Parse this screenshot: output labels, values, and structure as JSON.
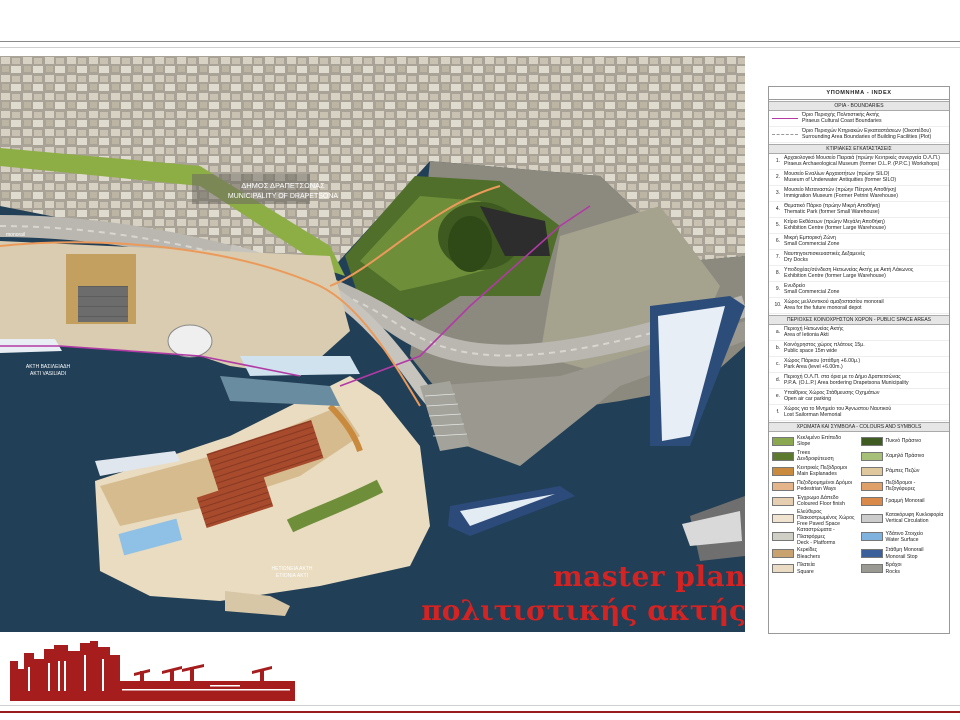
{
  "title": {
    "line1": "master plan",
    "line2": "πολιτιστικής ακτής"
  },
  "map_labels": {
    "municipality_gr": "ΔΗΜΟΣ ΔΡΑΠΕΤΣΩΝΑΣ",
    "municipality_en": "MUNICIPALITY OF DRAPETSONA",
    "akti_vasileiadi": "ΑΚΤΗ ΒΑΣΙΛΕΙΑΔΗ",
    "akti_vasileiadi_en": "ΑΚΤΙ VASILIADI",
    "etioneia_gr": "ΗΕΤΙΩΝΕΙΑ ΑΚΤΗ",
    "etioneia_en": "ETIONIA AKTI",
    "monorail": "monorail"
  },
  "legend": {
    "header": "ΥΠΟΜΝΗΜΑ - INDEX",
    "boundaries_title": "ΟΡΙΑ - BOUNDARIES",
    "boundaries": [
      {
        "gr": "Όριο Περιοχής Πολιτιστικής Ακτής",
        "en": "Piraeus Cultural Coast Boundaries",
        "color": "#b23aa6"
      },
      {
        "gr": "Όριο Περιοχών Κτηριακών Εγκαταστάσεων (Οικοπέδου)",
        "en": "Surrounding Area Boundaries of Building Facilities (Plot)",
        "color": "#999999"
      }
    ],
    "facilities_title": "ΚΤΙΡΙΑΚΕΣ ΕΓΚΑΤΑΣΤΑΣΕΙΣ",
    "facilities": [
      {
        "num": "1.",
        "gr": "Αρχαιολογικό Μουσείο Πειραιά (πρώην Κεντρικές συνεργεία Ο.Λ.Π.)",
        "en": "Piraeus Archaeological Museum (former O.L.P. (P.P.C.) Workshops)"
      },
      {
        "num": "2.",
        "gr": "Μουσείο Εναλίων Αρχαιοτήτων (πρώην SILO)",
        "en": "Museum of Underwater Antiquities (former SILO)"
      },
      {
        "num": "3.",
        "gr": "Μουσείο Μεταναστών (πρώην Πέτρινη Αποθήκη)",
        "en": "Immigration Museum (Former Petrini Warehouse)"
      },
      {
        "num": "4.",
        "gr": "Θεματικό Πάρκο (πρώην Μικρή Αποθήκη)",
        "en": "Thematic Park (former Small Warehouse)"
      },
      {
        "num": "5.",
        "gr": "Κτίριο Εκθέσεων (πρώην Μεγάλη Αποθήκη)",
        "en": "Exhibition Centre (former Large Warehouse)"
      },
      {
        "num": "6.",
        "gr": "Μικρή Εμπορική Ζώνη",
        "en": "Small Commercial Zone"
      },
      {
        "num": "7.",
        "gr": "Ναυπηγοεπισκευαστικές Δεξαμενές",
        "en": "Dry Docks"
      },
      {
        "num": "8.",
        "gr": "Υποδοχέας/σύνδεση Ηετιωνείας Ακτής με Ακτή Λάκωνος",
        "en": "Exhibition Centre (former Large Warehouse)"
      },
      {
        "num": "9.",
        "gr": "Ενυδρείο",
        "en": "Small Commercial Zone"
      },
      {
        "num": "10.",
        "gr": "Χώρος μελλοντικού αμαξοστασίου monorail",
        "en": "Area for the future monorail depot"
      }
    ],
    "public_title": "ΠΕΡΙΟΧΕΣ ΚΟΙΝΟΧΡΗΣΤΩΝ ΧΩΡΩΝ - PUBLIC SPACE AREAS",
    "public": [
      {
        "num": "a.",
        "gr": "Περιοχή Ηετιωνείας Ακτής",
        "en": "Area of Ietionia Akti"
      },
      {
        "num": "b.",
        "gr": "Κοινόχρηστος χώρος πλάτους 15μ.",
        "en": "Public space 15m wide"
      },
      {
        "num": "c.",
        "gr": "Χώρος Πάρκου (στάθμη +6.00μ.)",
        "en": "Park Area (level +6.00m.)"
      },
      {
        "num": "d.",
        "gr": "Περιοχή Ο.Λ.Π. στα όρια με το Δήμο Δραπετσώνας",
        "en": "P.P.A. (O.L.P.) Area bordering Drapetsona Municipality"
      },
      {
        "num": "e.",
        "gr": "Υπαίθριος Χώρος Στάθμευσης Οχημάτων",
        "en": "Open air car parking"
      },
      {
        "num": "f.",
        "gr": "Χώρος για το Μνημείο του Άγνωστου Ναυτικού",
        "en": "Lost Sailorman Memorial"
      }
    ],
    "symbols_title": "ΧΡΩΜΑΤΑ ΚΑΙ ΣΥΜΒΟΛΑ - COLOURS AND SYMBOLS",
    "symbols": [
      {
        "gr": "Κεκλιμένο Επίπεδο",
        "en": "Slope",
        "color": "#8aa850"
      },
      {
        "gr": "Πυκνό Πράσινο",
        "en": "",
        "color": "#3e5b22"
      },
      {
        "gr": "Trees",
        "en": "Δενδροφύτευση",
        "color": "#5b7a2f"
      },
      {
        "gr": "Χαμηλό Πράσινο",
        "en": "",
        "color": "#a6c07a"
      },
      {
        "gr": "Κεντρικές Πεζόδρομοι",
        "en": "Main Esplanades",
        "color": "#c98a3e"
      },
      {
        "gr": "Ράμπες Πεζών",
        "en": "",
        "color": "#e0c89e"
      },
      {
        "gr": "Πεζοδρομημένοι Δρόμοι",
        "en": "Pedestrian Ways",
        "color": "#e4b58a"
      },
      {
        "gr": "Πεζόδρομοι - Πεζογέφυρες",
        "en": "",
        "color": "#e0a06a"
      },
      {
        "gr": "Έγχρωμο Δάπεδο",
        "en": "Coloured Floor finish",
        "color": "#e6cfb0"
      },
      {
        "gr": "Γραμμή Monorail",
        "en": "",
        "color": "#d98a4a"
      },
      {
        "gr": "Ελεύθερος Πλακοστρωμένος Χώρος",
        "en": "Free Paved Space",
        "color": "#f0e4d0"
      },
      {
        "gr": "Κατακόρυφη Κυκλοφορία",
        "en": "Vertical Circulation",
        "color": "#cccccc"
      },
      {
        "gr": "Καταστρώματα - Πλατφόρμες",
        "en": "Deck - Platforms",
        "color": "#cfcfc6"
      },
      {
        "gr": "Υδάτινο Στοιχείο",
        "en": "Water Surface",
        "color": "#7fb3dd"
      },
      {
        "gr": "Κερκίδες",
        "en": "Bleachers",
        "color": "#c9a36f"
      },
      {
        "gr": "Στάθμη Monorail",
        "en": "Monorail Stop",
        "color": "#3a5f9a"
      },
      {
        "gr": "Πλατεία",
        "en": "Square",
        "color": "#eadcc4"
      },
      {
        "gr": "Βράχοι",
        "en": "Rocks",
        "color": "#9a9a92"
      }
    ]
  }
}
